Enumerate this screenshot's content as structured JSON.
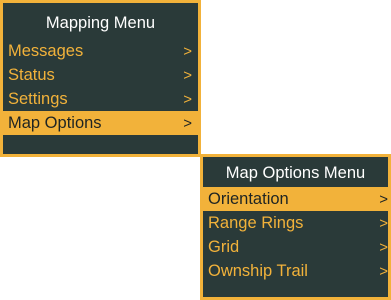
{
  "main_menu": {
    "title": "Mapping Menu",
    "items": [
      {
        "label": "Messages",
        "arrow": ">"
      },
      {
        "label": "Status",
        "arrow": ">"
      },
      {
        "label": "Settings",
        "arrow": ">"
      },
      {
        "label": "Map Options",
        "arrow": ">",
        "selected": true
      }
    ]
  },
  "sub_menu": {
    "title": "Map Options Menu",
    "items": [
      {
        "label": "Orientation",
        "arrow": ">",
        "selected": true
      },
      {
        "label": "Range Rings",
        "arrow": ">"
      },
      {
        "label": "Grid",
        "arrow": ">"
      },
      {
        "label": "Ownship Trail",
        "arrow": ">"
      }
    ]
  },
  "colors": {
    "menu_background": "#2a3a39",
    "accent": "#f2b23a",
    "title_text": "#ffffff"
  }
}
